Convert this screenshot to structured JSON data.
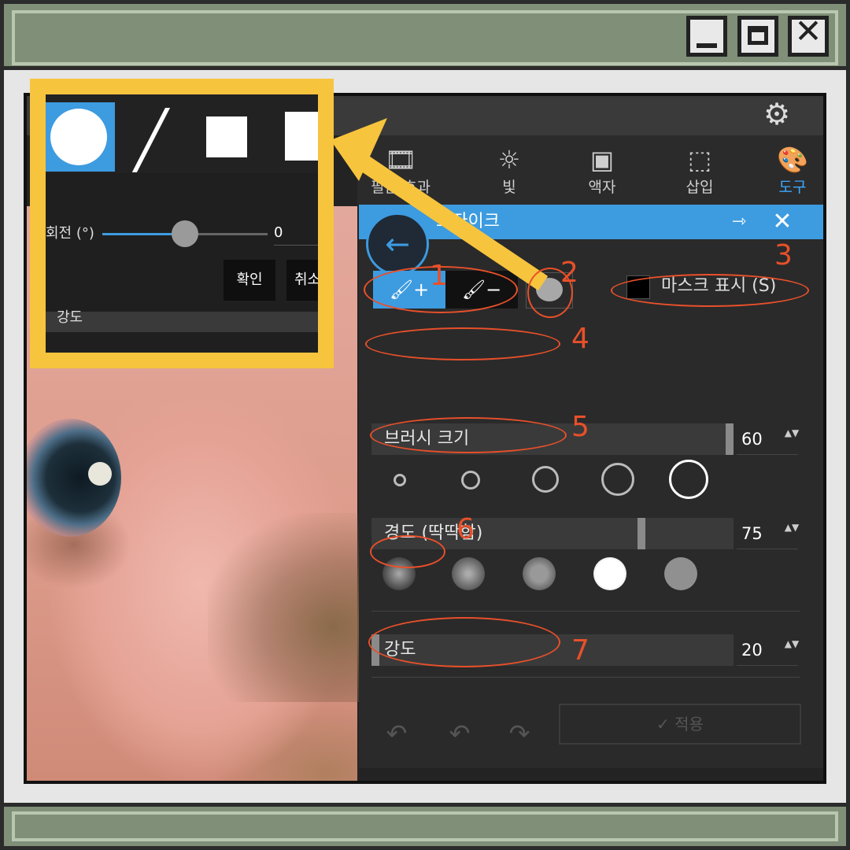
{
  "window": {
    "min_icon": "minimize-icon",
    "max_icon": "maximize-icon",
    "close_glyph": "✕"
  },
  "toolbar": {
    "gear_icon": "⚙"
  },
  "tabs": [
    {
      "label": "필름 효과",
      "icon": "film-icon",
      "glyph": "🎞"
    },
    {
      "label": "빛",
      "icon": "sun-icon",
      "glyph": "☼"
    },
    {
      "label": "액자",
      "icon": "frame-icon",
      "glyph": "▣"
    },
    {
      "label": "삽입",
      "icon": "star-frame-icon",
      "glyph": "⬚"
    },
    {
      "label": "도구",
      "icon": "palette-icon",
      "glyph": "🎨"
    }
  ],
  "panel": {
    "title": "모자이크",
    "pin_glyph": "⇾",
    "close_glyph": "✕",
    "back_glyph": "←",
    "brush_add_glyph": "🖌+",
    "brush_sub_glyph": "🖌−",
    "mask_label": "마스크 표시 (S)",
    "brush_size": {
      "label": "브러시 크기",
      "value": "60",
      "level": 1.0
    },
    "hardness": {
      "label": "경도 (딱딱함)",
      "value": "75",
      "level": 0.75
    },
    "strength": {
      "label": "강도",
      "value": "20",
      "level": 0.0
    },
    "spin_glyph": "▲▼",
    "apply_label": "✓  적용",
    "undo_all_glyph": "↶",
    "undo_glyph": "↶",
    "redo_glyph": "↷"
  },
  "zoom": {
    "rotation_label": "회전 (°)",
    "rotation_value": "0",
    "ok_label": "확인",
    "cancel_label": "취소",
    "strength_label": "강도"
  },
  "annotations": [
    "1",
    "2",
    "3",
    "4",
    "5",
    "6",
    "7"
  ],
  "colors": {
    "accent": "#3d9be0",
    "annotation": "#e8502a",
    "callout": "#f7c43d",
    "frame": "#7f8f78"
  }
}
